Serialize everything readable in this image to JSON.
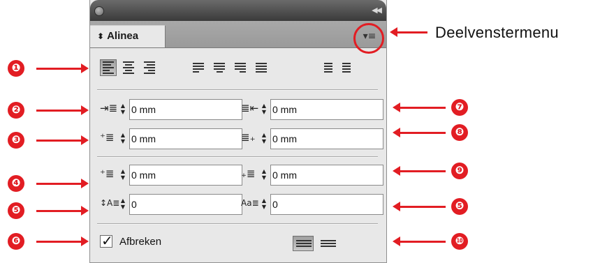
{
  "panel": {
    "tab_label": "Alinea",
    "tab_icon": "double-arrow-updown-icon",
    "menu_icon": "panel-menu-icon",
    "collapse_icon": "collapse-panel-icon",
    "alignment_buttons": [
      {
        "name": "align-left",
        "selected": true
      },
      {
        "name": "align-center",
        "selected": false
      },
      {
        "name": "align-right",
        "selected": false
      },
      {
        "name": "justify-last-left",
        "selected": false
      },
      {
        "name": "justify-last-center",
        "selected": false
      },
      {
        "name": "justify-last-right",
        "selected": false
      },
      {
        "name": "justify-all",
        "selected": false
      },
      {
        "name": "align-towards-spine",
        "selected": false
      },
      {
        "name": "align-away-from-spine",
        "selected": false
      }
    ],
    "fields": {
      "left_indent": "0 mm",
      "right_indent": "0 mm",
      "first_line_indent": "0 mm",
      "last_line_indent": "0 mm",
      "space_before": "0 mm",
      "space_after": "0 mm",
      "drop_cap_lines": "0",
      "drop_cap_chars": "0"
    },
    "hyphenate": {
      "label": "Afbreken",
      "checked": true
    },
    "composer_buttons": [
      {
        "name": "do-not-align-to-baseline-grid",
        "selected": true
      },
      {
        "name": "align-to-baseline-grid",
        "selected": false
      }
    ]
  },
  "callouts": {
    "menu_label": "Deelvenstermenu",
    "numbers": [
      "❶",
      "❷",
      "❸",
      "❹",
      "❺",
      "❻",
      "❼",
      "❽",
      "❾",
      "❺",
      "❿"
    ]
  },
  "colors": {
    "accent": "#e21d23",
    "panel_bg": "#e8e8e8"
  }
}
